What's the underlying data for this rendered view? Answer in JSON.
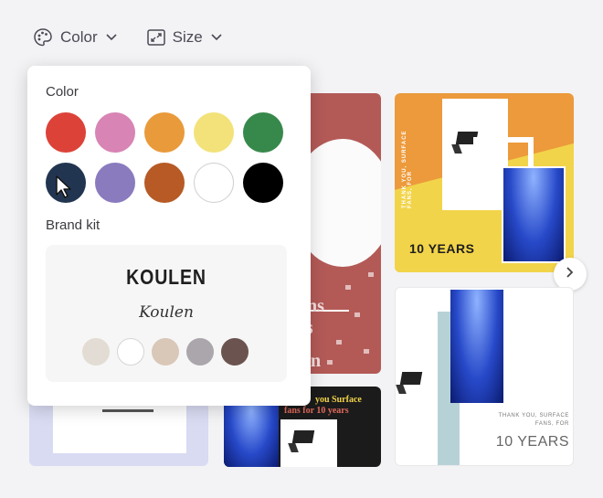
{
  "toolbar": {
    "color_label": "Color",
    "size_label": "Size"
  },
  "popover": {
    "color_heading": "Color",
    "colors": [
      "#dc4238",
      "#d884b4",
      "#e99a3a",
      "#f3e27a",
      "#37894b",
      "#223550",
      "#8a7bbf",
      "#b75a25",
      "#ffffff",
      "#000000"
    ],
    "brand_kit_heading": "Brand kit",
    "brand_font_heading": "KOULEN",
    "brand_font_script": "Koulen",
    "brand_colors": [
      "#e2dcd4",
      "#ffffff",
      "#d9c7b8",
      "#aba6ac",
      "#6b5450"
    ]
  },
  "templates": {
    "red_card_text_1": "n",
    "red_card_text_2": "ans",
    "red_card_text_3": "rs",
    "orange_card_thanks": "THANK YOU, SURFACE FANS, FOR",
    "orange_card_years": "10 YEARS",
    "white_card_thanks": "THANK YOU, SURFACE FANS, FOR",
    "white_card_years": "10 YEARS",
    "dark_card_line1": "you Surface",
    "dark_card_line2": "fans for 10 years"
  }
}
